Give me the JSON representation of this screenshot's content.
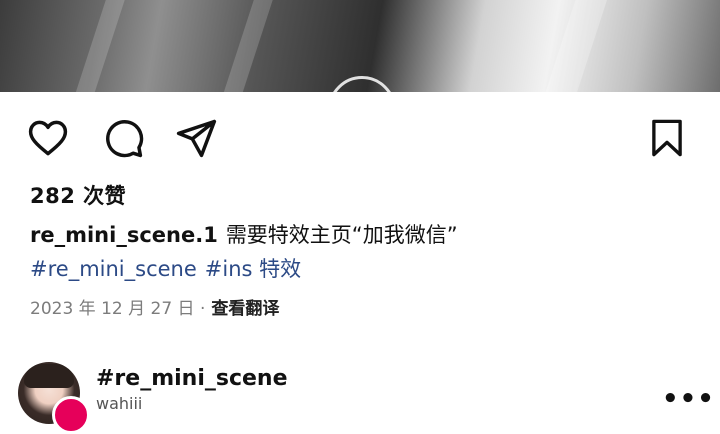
{
  "post": {
    "likes": "282 次赞",
    "caption_user": "re_mini_scene.1",
    "caption_text": "需要特效主页“加我微信”",
    "hashtags": [
      "#re_mini_scene",
      "#ins 特效"
    ],
    "date": "2023 年 12 月 27 日 ·",
    "translate_label": "查看翻译"
  },
  "suggestion": {
    "title": "#re_mini_scene",
    "subtitle": "wahiii",
    "more": "•••"
  },
  "icons": {
    "like": "heart-icon",
    "comment": "comment-icon",
    "share": "send-icon",
    "save": "bookmark-icon"
  }
}
